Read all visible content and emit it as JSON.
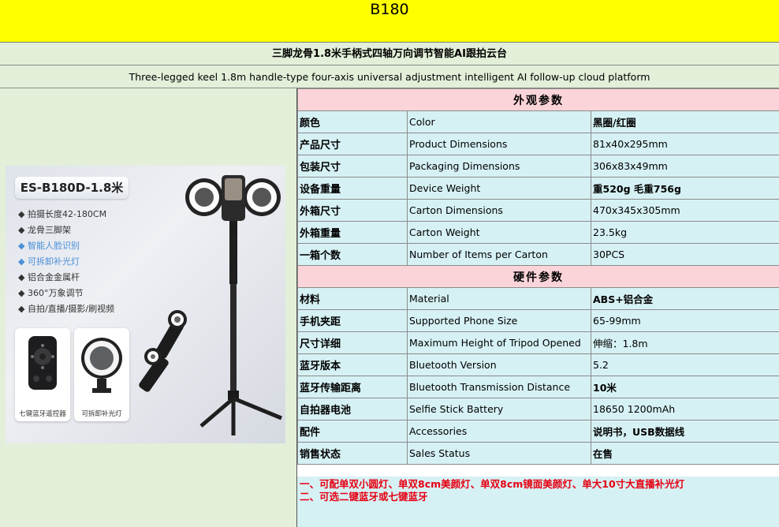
{
  "header": {
    "title": "B180",
    "name_zh": "三脚龙骨1.8米手柄式四轴万向调节智能AI跟拍云台",
    "name_en": "Three-legged keel 1.8m handle-type four-axis universal adjustment intelligent AI follow-up cloud platform"
  },
  "product_image": {
    "model": "ES-B180D-1.8米",
    "features": [
      "◆ 拍摄长度42-180CM",
      "◆ 龙骨三脚架",
      "◆ 智能人脸识别",
      "◆ 可拆卸补光灯",
      "◆ 铝合金金属杆",
      "◆ 360°万象调节",
      "◆ 自拍/直播/摄影/刷视频"
    ],
    "accessories": [
      "七键蓝牙遥控器",
      "可拆卸补光灯"
    ]
  },
  "specs": {
    "appearance_title": "外观参数",
    "appearance": [
      {
        "zh": "颜色",
        "en": "Color",
        "value": "黑圈/红圈"
      },
      {
        "zh": "产品尺寸",
        "en": "Product Dimensions",
        "value": "81x40x295mm"
      },
      {
        "zh": "包装尺寸",
        "en": "Packaging Dimensions",
        "value": "306x83x49mm"
      },
      {
        "zh": "设备重量",
        "en": "Device Weight",
        "value": "重520g  毛重756g"
      },
      {
        "zh": "外箱尺寸",
        "en": "Carton Dimensions",
        "value": "470x345x305mm"
      },
      {
        "zh": "外箱重量",
        "en": "Carton Weight",
        "value": "23.5kg"
      },
      {
        "zh": "一箱个数",
        "en": "Number of Items per Carton",
        "value": "30PCS"
      }
    ],
    "hardware_title": "硬件参数",
    "hardware": [
      {
        "zh": "材料",
        "en": "Material",
        "value": "ABS+铝合金"
      },
      {
        "zh": "手机夹距",
        "en": "Supported Phone Size",
        "value": "65-99mm"
      },
      {
        "zh": "尺寸详细",
        "en": "Maximum Height of Tripod Opened",
        "value": "伸缩：1.8m"
      },
      {
        "zh": "蓝牙版本",
        "en": "Bluetooth Version",
        "value": "5.2"
      },
      {
        "zh": "蓝牙传输距离",
        "en": "Bluetooth Transmission Distance",
        "value": "10米"
      },
      {
        "zh": "自拍器电池",
        "en": "Selfie Stick Battery",
        "value": "18650   1200mAh"
      },
      {
        "zh": "配件",
        "en": "Accessories",
        "value": "说明书，USB数据线"
      },
      {
        "zh": "销售状态",
        "en": "Sales Status",
        "value": "在售"
      }
    ]
  },
  "notes": [
    "一、可配单双小圆灯、单双8cm美颜灯、单双8cm镜面美颜灯、单大10寸大直播补光灯",
    "二、可选二键蓝牙或七键蓝牙"
  ],
  "colors": {
    "title_bg": "#ffff00",
    "band_bg": "#e3efd9",
    "section_bg": "#fbd4d9",
    "row_bg": "#d6f1f4",
    "note_text": "#e60012"
  }
}
